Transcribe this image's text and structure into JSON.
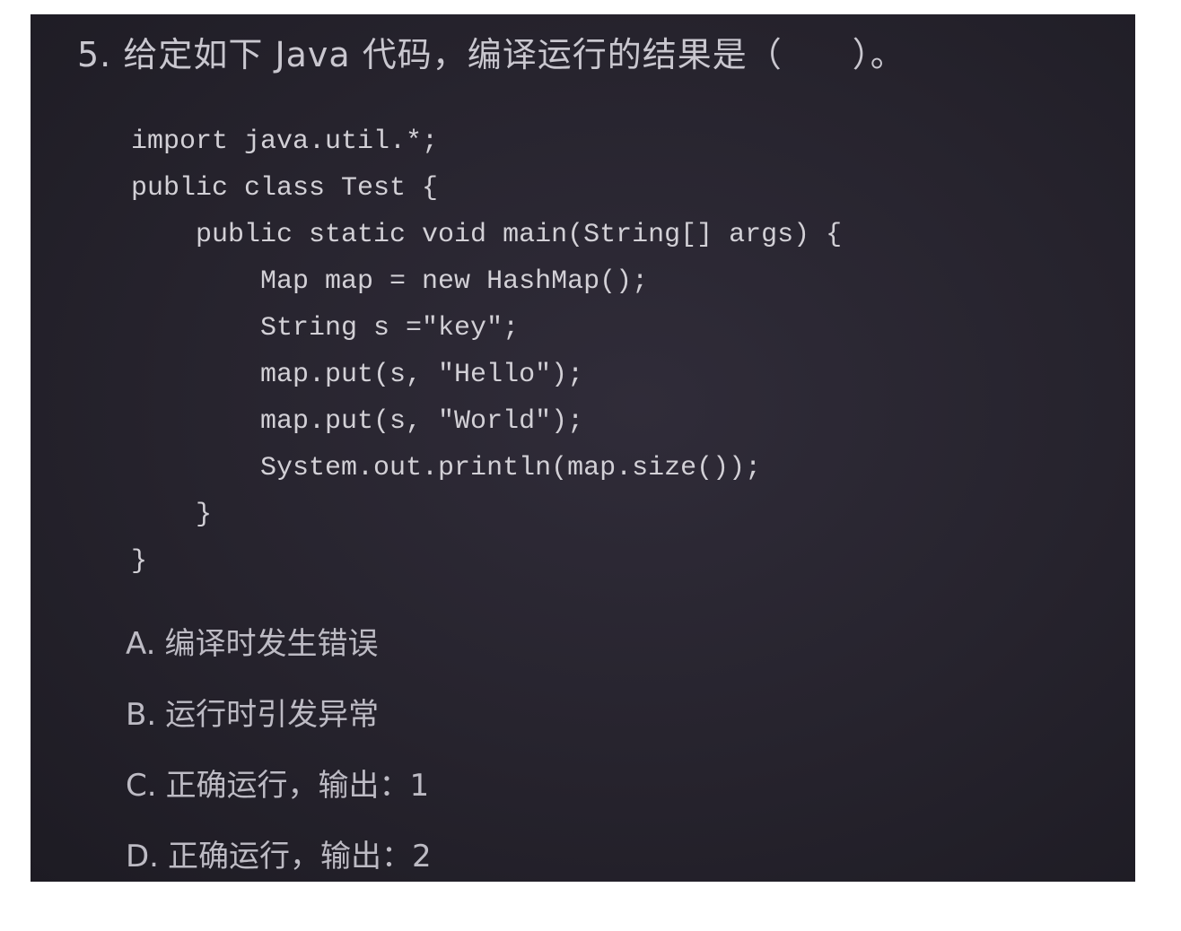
{
  "question": {
    "number": "5.",
    "text": "给定如下 Java 代码，编译运行的结果是（　　）。"
  },
  "code_lines": [
    "import java.util.*;",
    "public class Test {",
    "    public static void main(String[] args) {",
    "        Map map = new HashMap();",
    "        String s =\"key\";",
    "        map.put(s, \"Hello\");",
    "        map.put(s, \"World\");",
    "        System.out.println(map.size());",
    "    }",
    "}"
  ],
  "options": [
    {
      "key": "A.",
      "text": "编译时发生错误"
    },
    {
      "key": "B.",
      "text": "运行时引发异常"
    },
    {
      "key": "C.",
      "text": "正确运行，输出：1"
    },
    {
      "key": "D.",
      "text": "正确运行，输出：2"
    }
  ]
}
